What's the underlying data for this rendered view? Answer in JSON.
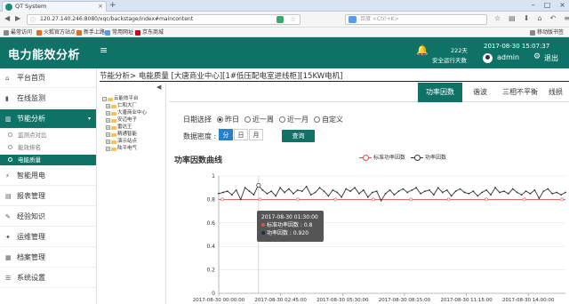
{
  "browser": {
    "tab_title": "QT System",
    "url": "120.27.140.246:8080/xqc/backstage/index#maincontent",
    "search_placeholder": "百度 <Ctrl+K>",
    "bookmarks": [
      "最常访问",
      "火狐官方站点",
      "新手上路",
      "常用网址",
      "京东商城"
    ],
    "mobile_bookmarks": "移动版书签"
  },
  "header": {
    "logo": "电力能效分析",
    "safe_days_value": "222天",
    "safe_days_label": "安全运行天数",
    "datetime": "2017-08-30 15:07:37",
    "username": "admin",
    "logout": "退出"
  },
  "sidebar": {
    "items": [
      {
        "label": "平台首页",
        "icon": "home-icon"
      },
      {
        "label": "在线监测",
        "icon": "monitor-icon"
      },
      {
        "label": "节能分析",
        "icon": "chart-icon"
      },
      {
        "label": "智能用电",
        "icon": "plug-icon"
      },
      {
        "label": "报表管理",
        "icon": "report-icon"
      },
      {
        "label": "经验知识",
        "icon": "book-icon"
      },
      {
        "label": "运维管理",
        "icon": "tools-icon"
      },
      {
        "label": "档案管理",
        "icon": "archive-icon"
      },
      {
        "label": "系统设置",
        "icon": "settings-icon"
      }
    ],
    "subitems": [
      "监测点对比",
      "能效排名",
      "电能质量"
    ]
  },
  "breadcrumb": "节能分析> 电能质量 [大唐商业中心][1#低压配电室进线柜][15KW电机]",
  "tree": {
    "root": "云能效平台",
    "nodes": [
      "仁和大厂",
      "大唐商业中心",
      "安迈电子",
      "雷达王",
      "精通智能",
      "演示站点",
      "陆平电气"
    ]
  },
  "tabs": [
    "功率因数",
    "谐波",
    "三相不平衡",
    "线损"
  ],
  "filters": {
    "date_label": "日期选择",
    "date_options": [
      "昨日",
      "近一周",
      "近一月",
      "自定义"
    ],
    "density_label": "数据密度 :",
    "density_options": [
      "分",
      "日",
      "月"
    ],
    "query_label": "查询"
  },
  "chart_title": "功率因数曲线",
  "colors": {
    "primary": "#0e7366",
    "std_line": "#d9534f",
    "pf_line": "#333333",
    "accent_blue": "#2a7fc9"
  },
  "chart_data": {
    "type": "line",
    "ylim": [
      0,
      1
    ],
    "yticks": [
      "0",
      "0.2",
      "0.4",
      "0.6",
      "0.8",
      "1"
    ],
    "xticks": [
      "2017-08-30 00:00:00",
      "2017-08-30 02:45:00",
      "2017-08-30 05:30:00",
      "2017-08-30 08:15:00",
      "2017-08-30 11:15:00",
      "2017-08-30 14:00:00"
    ],
    "series": [
      {
        "name": "标准功率因数",
        "values": [
          0.8,
          0.8
        ]
      },
      {
        "name": "功率因数",
        "values": [
          0.85,
          0.86,
          0.87,
          0.84,
          0.88,
          0.8,
          0.9,
          0.87,
          0.84,
          0.92,
          0.88,
          0.85,
          0.87,
          0.83,
          0.9,
          0.86,
          0.89,
          0.85,
          0.88,
          0.87,
          0.91,
          0.84,
          0.86,
          0.9,
          0.87,
          0.83,
          0.88,
          0.86,
          0.82,
          0.89,
          0.87,
          0.9,
          0.85,
          0.88,
          0.82,
          0.86,
          0.87,
          0.79,
          0.85,
          0.88,
          0.84,
          0.87,
          0.89,
          0.86,
          0.88,
          0.9,
          0.85,
          0.87,
          0.88,
          0.84,
          0.9,
          0.86,
          0.88,
          0.83,
          0.87,
          0.89,
          0.86,
          0.85,
          0.87,
          0.83,
          0.86,
          0.88,
          0.84,
          0.9,
          0.86,
          0.87,
          0.85,
          0.89,
          0.86,
          0.84,
          0.87,
          0.85,
          0.88,
          0.81,
          0.87,
          0.89,
          0.85,
          0.86,
          0.84,
          0.86
        ]
      }
    ]
  },
  "tooltip": {
    "time": "2017-08-30 01:30:00",
    "line1": "标准功率因数 : 0.8",
    "line2": "功率因数 : 0.920"
  }
}
